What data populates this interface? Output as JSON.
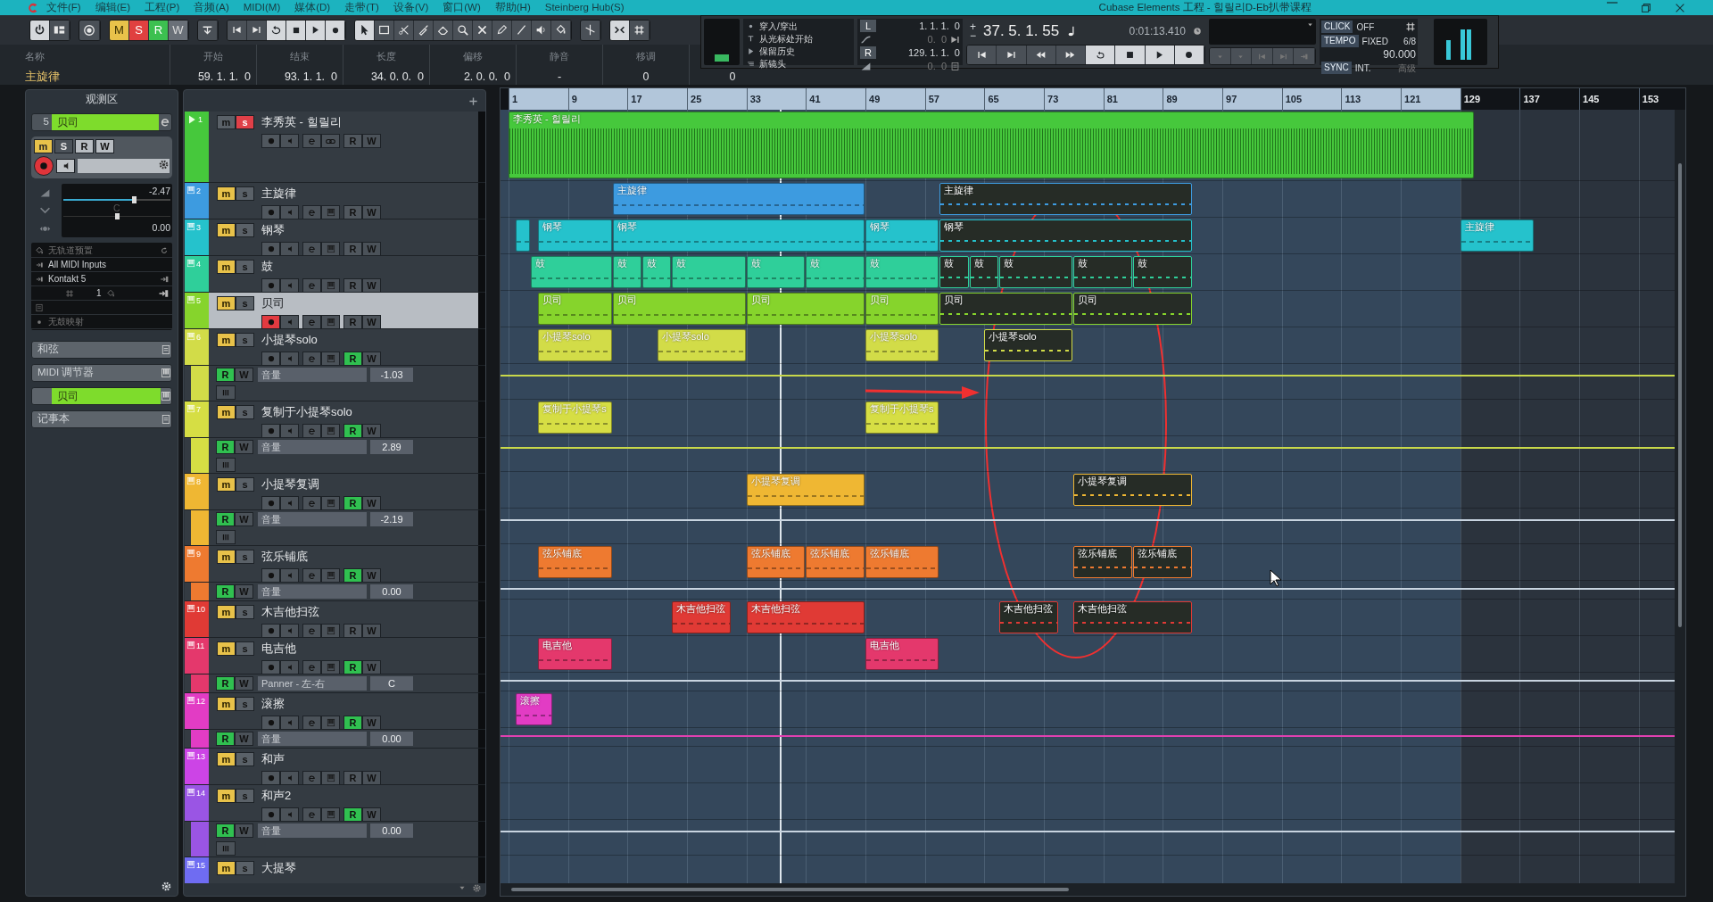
{
  "title_bar": {
    "title": "Cubase Elements 工程 - 힐릴리D-Eb扒带课程",
    "menu": [
      "文件(F)",
      "编辑(E)",
      "工程(P)",
      "音频(A)",
      "MIDI(M)",
      "媒体(D)",
      "走带(T)",
      "设备(V)",
      "窗口(W)",
      "帮助(H)",
      "Steinberg Hub(S)"
    ]
  },
  "toolbar": {
    "automation": [
      {
        "label": "M",
        "kind": "mute"
      },
      {
        "label": "S",
        "kind": "solo"
      },
      {
        "label": "R",
        "kind": "read"
      },
      {
        "label": "W",
        "kind": "write"
      }
    ]
  },
  "info_line": {
    "name_label": "名称",
    "name": "主旋律",
    "fields": [
      {
        "label": "开始",
        "value": "59. 1. 1.  0",
        "kind": "position"
      },
      {
        "label": "结束",
        "value": "93. 1. 1.  0",
        "kind": "position"
      },
      {
        "label": "长度",
        "value": "34. 0. 0.  0",
        "kind": "position"
      },
      {
        "label": "偏移",
        "value": "2. 0. 0.  0",
        "kind": "position"
      },
      {
        "label": "静音",
        "value": "-",
        "kind": "text"
      },
      {
        "label": "移调",
        "value": "0",
        "kind": "text"
      },
      {
        "value": "0",
        "kind": "text"
      }
    ]
  },
  "transport": {
    "punch": [
      "穿入/穿出",
      "从光标处开始",
      "保留历史",
      "新镜头"
    ],
    "locators": [
      {
        "label": "L",
        "position": "1. 1. 1.  0",
        "offset": "0.  0"
      },
      {
        "label": "R",
        "position": "129. 1. 1.  0",
        "offset": "0.  0"
      }
    ],
    "nudge": [
      "+",
      "−"
    ],
    "position": "37. 5. 1. 55",
    "time": "0:01:13.410",
    "click": {
      "label": "CLICK",
      "value": "OFF"
    },
    "tempo": {
      "label": "TEMPO",
      "value": "FIXED",
      "signature": "6/8",
      "bpm": "90.000"
    },
    "sync": {
      "label": "SYNC",
      "value": "INT.",
      "extra": "高级"
    }
  },
  "inspector": {
    "title": "观测区",
    "track_number": "5",
    "track_name": "贝司",
    "labels": [
      "m",
      "S",
      "R",
      "W"
    ],
    "volume": "-2.47",
    "volume_level": {
      "level": 0.66
    },
    "pan": "C",
    "pan_level": {
      "level": 0.5
    },
    "delay": "0.00",
    "routing": [
      "无轨道预置",
      "All MIDI Inputs",
      "Kontakt 5"
    ],
    "channel": "1",
    "drum_map": "无鼓映射",
    "sections": [
      {
        "label": "和弦",
        "kind": "plain"
      },
      {
        "label": "MIDI 调节器",
        "kind": "plain"
      },
      {
        "label": "贝司",
        "kind": "track"
      },
      {
        "label": "记事本",
        "kind": "plain"
      }
    ]
  },
  "ruler": [
    "1",
    "9",
    "17",
    "25",
    "33",
    "41",
    "49",
    "57",
    "65",
    "73",
    "81",
    "89",
    "97",
    "105",
    "113",
    "121",
    "129",
    "137",
    "145",
    "153"
  ],
  "tracks": [
    {
      "number": "1",
      "name": "李秀英 - 힐릴리",
      "kind": "audio",
      "color": "#46c83c",
      "muted": false,
      "soloed": true,
      "record": false,
      "read": false,
      "selected": false,
      "labels": [
        "m",
        "s",
        "R",
        "W"
      ],
      "clips": [
        {
          "label": "李秀英 - 힐릴리",
          "selected": false
        }
      ]
    },
    {
      "number": "2",
      "name": "主旋律",
      "kind": "midi",
      "color": "#3d9be0",
      "muted": true,
      "soloed": false,
      "record": false,
      "read": false,
      "selected": false,
      "labels": [
        "m",
        "s",
        "R",
        "W"
      ],
      "clips": [
        {
          "label": "主旋律",
          "selected": false
        },
        {
          "label": "主旋律",
          "selected": true
        }
      ]
    },
    {
      "number": "3",
      "name": "钢琴",
      "kind": "midi",
      "color": "#25c2cc",
      "muted": true,
      "soloed": false,
      "record": false,
      "read": false,
      "selected": false,
      "labels": [
        "m",
        "s",
        "R",
        "W"
      ],
      "clips": [
        {
          "selected": false
        },
        {
          "label": "钢琴",
          "selected": false
        },
        {
          "label": "钢琴",
          "selected": false
        },
        {
          "label": "钢琴",
          "selected": false
        },
        {
          "label": "钢琴",
          "selected": true
        },
        {
          "label": "主旋律",
          "selected": false
        }
      ]
    },
    {
      "number": "4",
      "name": "鼓",
      "kind": "midi",
      "color": "#2fcf9a",
      "muted": true,
      "soloed": false,
      "record": false,
      "read": false,
      "selected": false,
      "labels": [
        "m",
        "s",
        "R",
        "W"
      ],
      "clips": [
        {
          "label": "鼓",
          "selected": false
        },
        {
          "label": "鼓",
          "selected": false
        },
        {
          "label": "鼓",
          "selected": false
        },
        {
          "label": "鼓",
          "selected": false
        },
        {
          "label": "鼓",
          "selected": false
        },
        {
          "label": "鼓",
          "selected": false
        },
        {
          "label": "鼓",
          "selected": false
        },
        {
          "label": "鼓",
          "selected": true
        },
        {
          "label": "鼓",
          "selected": true
        },
        {
          "label": "鼓",
          "selected": true
        },
        {
          "label": "鼓",
          "selected": true
        },
        {
          "label": "鼓",
          "selected": true
        }
      ]
    },
    {
      "number": "5",
      "name": "贝司",
      "kind": "midi",
      "color": "#86d42c",
      "muted": true,
      "soloed": false,
      "record": true,
      "read": false,
      "selected": true,
      "labels": [
        "m",
        "s",
        "R",
        "W"
      ],
      "clips": [
        {
          "label": "贝司",
          "selected": false
        },
        {
          "label": "贝司",
          "selected": false
        },
        {
          "label": "贝司",
          "selected": false
        },
        {
          "label": "贝司",
          "selected": false
        },
        {
          "label": "贝司",
          "selected": true
        },
        {
          "label": "贝司",
          "selected": true
        }
      ]
    },
    {
      "number": "6",
      "name": "小提琴solo",
      "kind": "midi",
      "color": "#d2dc48",
      "muted": true,
      "soloed": false,
      "record": false,
      "read": true,
      "selected": false,
      "labels": [
        "m",
        "s",
        "R",
        "W"
      ],
      "clips": [
        {
          "label": "小提琴solo",
          "selected": false
        },
        {
          "label": "小提琴solo",
          "selected": false
        },
        {
          "label": "小提琴solo",
          "selected": false
        },
        {
          "label": "小提琴solo",
          "selected": true
        }
      ],
      "lanes": [
        {
          "labels": [
            "R",
            "W"
          ],
          "param": "音量",
          "value": "-1.03",
          "read": true,
          "lane_button": true,
          "color": "#c8d84a"
        }
      ]
    },
    {
      "number": "7",
      "name": "复制于小提琴solo",
      "kind": "midi",
      "color": "#d6de44",
      "muted": true,
      "soloed": false,
      "record": false,
      "read": true,
      "selected": false,
      "labels": [
        "m",
        "s",
        "R",
        "W"
      ],
      "clips": [
        {
          "label": "复制于小提琴s",
          "selected": false
        },
        {
          "label": "复制于小提琴s",
          "selected": false
        }
      ],
      "lanes": [
        {
          "labels": [
            "R",
            "W"
          ],
          "param": "音量",
          "value": "2.89",
          "read": true,
          "lane_button": true,
          "color": "#c8d84a"
        }
      ]
    },
    {
      "number": "8",
      "name": "小提琴复调",
      "kind": "midi",
      "color": "#efb733",
      "muted": true,
      "soloed": false,
      "record": false,
      "read": true,
      "selected": false,
      "labels": [
        "m",
        "s",
        "R",
        "W"
      ],
      "clips": [
        {
          "label": "小提琴复调",
          "selected": false
        },
        {
          "label": "小提琴复调",
          "selected": true
        }
      ],
      "lanes": [
        {
          "labels": [
            "R",
            "W"
          ],
          "param": "音量",
          "value": "-2.19",
          "read": true,
          "lane_button": true,
          "color": "#c8d4e0"
        }
      ]
    },
    {
      "number": "9",
      "name": "弦乐铺底",
      "kind": "midi",
      "color": "#ee7a30",
      "muted": true,
      "soloed": false,
      "record": false,
      "read": true,
      "selected": false,
      "labels": [
        "m",
        "s",
        "R",
        "W"
      ],
      "clips": [
        {
          "label": "弦乐铺底",
          "selected": false
        },
        {
          "label": "弦乐铺底",
          "selected": false
        },
        {
          "label": "弦乐铺底",
          "selected": false
        },
        {
          "label": "弦乐铺底",
          "selected": false
        },
        {
          "label": "弦乐铺底",
          "selected": true
        },
        {
          "label": "弦乐铺底",
          "selected": true
        }
      ],
      "lanes": [
        {
          "labels": [
            "R",
            "W"
          ],
          "param": "音量",
          "value": "0.00",
          "read": true,
          "lane_button": false,
          "color": "#c8d4e0"
        }
      ]
    },
    {
      "number": "10",
      "name": "木吉他扫弦",
      "kind": "midi",
      "color": "#e03a35",
      "muted": true,
      "soloed": false,
      "record": false,
      "read": false,
      "selected": false,
      "labels": [
        "m",
        "s",
        "R",
        "W"
      ],
      "clips": [
        {
          "label": "木吉他扫弦",
          "selected": false
        },
        {
          "label": "木吉他扫弦",
          "selected": false
        },
        {
          "label": "木吉他扫弦",
          "selected": true
        },
        {
          "label": "木吉他扫弦",
          "selected": true
        }
      ]
    },
    {
      "number": "11",
      "name": "电吉他",
      "kind": "midi",
      "color": "#e4386c",
      "muted": true,
      "soloed": false,
      "record": false,
      "read": true,
      "selected": false,
      "labels": [
        "m",
        "s",
        "R",
        "W"
      ],
      "clips": [
        {
          "label": "电吉他",
          "selected": false
        },
        {
          "label": "电吉他",
          "selected": false
        }
      ],
      "lanes": [
        {
          "labels": [
            "R",
            "W"
          ],
          "param": "Panner - 左-右",
          "value": "C",
          "read": true,
          "lane_button": false,
          "color": "#c8d4e0"
        }
      ]
    },
    {
      "number": "12",
      "name": "滚擦",
      "kind": "midi",
      "color": "#e23cc4",
      "muted": true,
      "soloed": false,
      "record": false,
      "read": true,
      "selected": false,
      "labels": [
        "m",
        "s",
        "R",
        "W"
      ],
      "clips": [
        {
          "label": "滚擦",
          "selected": false
        }
      ],
      "lanes": [
        {
          "labels": [
            "R",
            "W"
          ],
          "param": "音量",
          "value": "0.00",
          "read": true,
          "lane_button": false,
          "color": "#e040b0"
        }
      ]
    },
    {
      "number": "13",
      "name": "和声",
      "kind": "midi",
      "color": "#cc44e6",
      "muted": true,
      "soloed": false,
      "record": false,
      "read": false,
      "selected": false,
      "labels": [
        "m",
        "s",
        "R",
        "W"
      ]
    },
    {
      "number": "14",
      "name": "和声2",
      "kind": "midi",
      "color": "#9a55e4",
      "muted": true,
      "soloed": false,
      "record": false,
      "read": true,
      "selected": false,
      "labels": [
        "m",
        "s",
        "R",
        "W"
      ],
      "lanes": [
        {
          "labels": [
            "R",
            "W"
          ],
          "param": "音量",
          "value": "0.00",
          "read": true,
          "lane_button": true,
          "color": "#c8d4e0"
        }
      ]
    },
    {
      "number": "15",
      "name": "大提琴",
      "kind": "midi",
      "color": "#6f6cf2",
      "muted": true,
      "soloed": false,
      "selected": false,
      "labels": [
        "m",
        "s"
      ]
    }
  ]
}
